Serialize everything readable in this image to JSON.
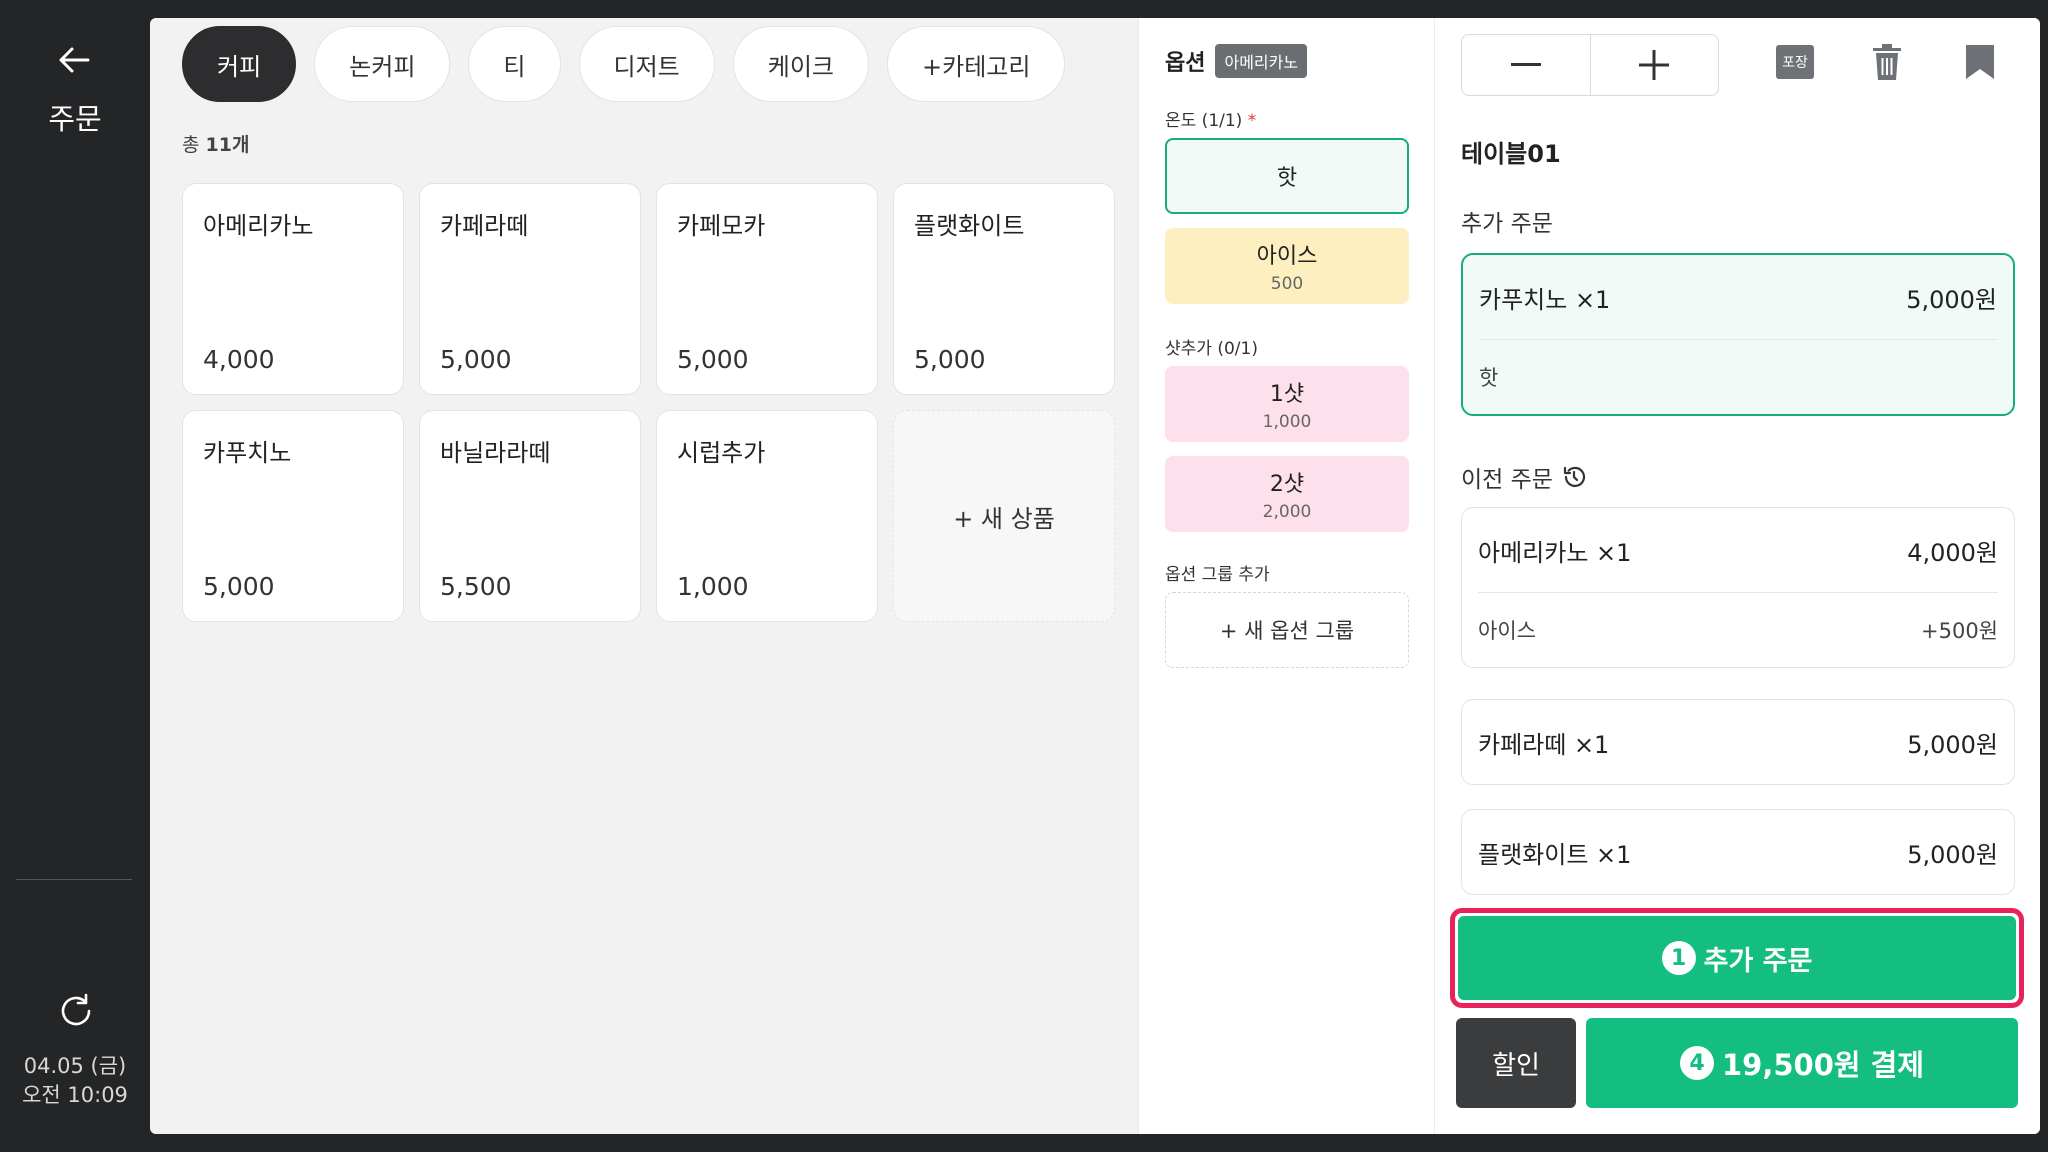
{
  "rail": {
    "title": "주문",
    "date": "04.05 (금)",
    "time": "오전 10:09"
  },
  "categories": {
    "tabs": [
      "커피",
      "논커피",
      "티",
      "디저트",
      "케이크",
      "+카테고리"
    ],
    "active": "커피",
    "count_prefix": "총 ",
    "count_value": "11개"
  },
  "products": [
    {
      "name": "아메리카노",
      "price": "4,000"
    },
    {
      "name": "카페라떼",
      "price": "5,000"
    },
    {
      "name": "카페모카",
      "price": "5,000"
    },
    {
      "name": "플랫화이트",
      "price": "5,000"
    },
    {
      "name": "카푸치노",
      "price": "5,000"
    },
    {
      "name": "바닐라라떼",
      "price": "5,500"
    },
    {
      "name": "시럽추가",
      "price": "1,000"
    }
  ],
  "new_product_label": "+ 새 상품",
  "options": {
    "title": "옵션",
    "product_badge": "아메리카노",
    "temp_label": "온도 (1/1)",
    "required_mark": "*",
    "hot": "핫",
    "ice": "아이스",
    "ice_price": "500",
    "shot_label": "샷추가 (0/1)",
    "shot1": "1샷",
    "shot1_price": "1,000",
    "shot2": "2샷",
    "shot2_price": "2,000",
    "group_label": "옵션 그룹 추가",
    "new_group": "+ 새 옵션 그룹"
  },
  "order": {
    "pack_label": "포장",
    "table": "테이블01",
    "additional_title": "추가 주문",
    "additional": {
      "name": "카푸치노 ×1",
      "price": "5,000원",
      "option": "핫"
    },
    "previous_title": "이전 주문",
    "previous": [
      {
        "name": "아메리카노 ×1",
        "price": "4,000원",
        "option": "아이스",
        "option_price": "+500원"
      },
      {
        "name": "카페라떼 ×1",
        "price": "5,000원"
      },
      {
        "name": "플랫화이트 ×1",
        "price": "5,000원"
      }
    ],
    "add_badge": "1",
    "add_label": "추가 주문",
    "discount_label": "할인",
    "pay_badge": "4",
    "pay_label": "19,500원 결제"
  },
  "colors": {
    "accent": "#14bd80",
    "highlight": "#e8225a",
    "dark": "#242526"
  }
}
